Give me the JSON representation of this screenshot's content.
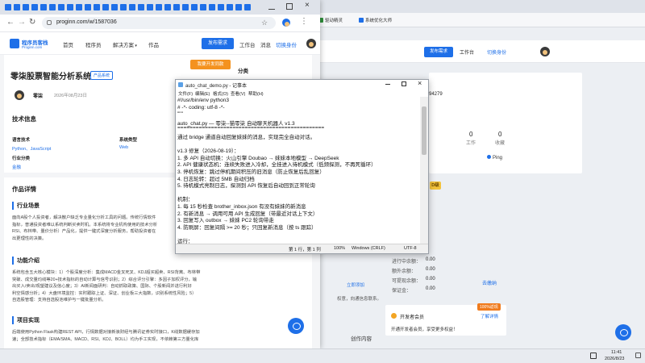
{
  "background_browser": {
    "bookmarks": [
      {
        "label": "驱动精灵",
        "color": "#2f8f3a"
      },
      {
        "label": "系统优化大师",
        "color": "#1e6fe8"
      }
    ],
    "header": {
      "publish_label": "发布需求",
      "workbench_label": "工作台",
      "switch_identity_label": "切换身份"
    },
    "partial_id": "94279",
    "stats": [
      {
        "value": "0",
        "label": "工作"
      },
      {
        "value": "0",
        "label": "收藏"
      }
    ],
    "ping_label": "Ping",
    "level_badge": "D级",
    "balances": [
      {
        "label": "进行中余额：",
        "value": "0.00"
      },
      {
        "label": "额外余额：",
        "value": "0.00"
      },
      {
        "label": "可提现余额：",
        "value": "0.00"
      },
      {
        "label": "保证金：",
        "value": "0.00"
      }
    ],
    "recharge_label": "去缴纳",
    "vip": {
      "badge": "100%返现",
      "title": "开发者会员",
      "link": "了解详情",
      "desc": "开通开发者会员，享受更多权益！"
    },
    "creation_label": "创作内容"
  },
  "browser": {
    "url": "proginn.com/w/1587036",
    "site_logo_cn": "程序员客栈",
    "site_logo_en": "Proginn.com",
    "nav": [
      "首页",
      "程序员",
      "解决方案",
      "作品"
    ],
    "publish_label": "发布需求",
    "workbench_label": "工作台",
    "messages_label": "消息",
    "switch_identity_label": "切换身份",
    "promo_button": "我要开发同款",
    "category_label": "分类",
    "product_title": "零柒股票智能分析系统",
    "product_tag": "产品系统",
    "author": "零柒",
    "date": "2026年08月23日",
    "tech_title": "技术信息",
    "lang_label": "语言技术",
    "lang_value": "Python、JavaScript",
    "system_label": "系统类型",
    "system_value": "Web",
    "industry_label": "行业分类",
    "industry_value": "金融",
    "detail_title": "作品详情",
    "industry_bg_title": "行业场景",
    "industry_bg_lines": [
      "面向A股个人投资者，解决散户缺乏专业量化分析工具的问题。传统行情软件",
      "指标，普通投资者难以系统判断买卖时机。本系统将专业机构使用的技术分析",
      "RSI、布林带、量价分析）产品化，提供一键式深度分析服务，帮助投资者在",
      "出更理性的决策。"
    ],
    "feature_title": "功能介绍",
    "feature_lines": [
      "系统包含五大核心模块：1）个股深度分析：集成MACD金叉死叉、KDJ超买超卖、RSI背离、布林带",
      "突破、成交量均线等20+技术指标的自动计算与信号识别；2）综合评分引擎：多因子加权评分，输",
      "出买入/卖出/观望建议及信心度；3）AI新闻面研判：自动抓取政策、国际、个股新闻并进行利好",
      "利空情感分析；4）大盘环境监控：实时跟踪上证、深证、创业板三大指数，识别系统性风险；5）",
      "自选股管理：支持自选股池维护与一键批量分析。"
    ],
    "impl_title": "项目实现",
    "impl_lines": [
      "后端使用Python Flask构建REST API，行情数据对接新浪财经与腾讯证券实时接口，K线数据缓存加",
      "速；全部技术指标（EMA/SMA、MACD、RSI、KDJ、BOLL）均为手工实现，不依赖第三方量化库"
    ],
    "side_link_add": "立即添加",
    "side_hint": "权意，向通信息联系。"
  },
  "notepad": {
    "title": "auto_chat_demo.py - 记事本",
    "menu": [
      "文件(F)",
      "编辑(E)",
      "格式(O)",
      "查看(V)",
      "帮助(H)"
    ],
    "lines": [
      "#!/usr/bin/env python3",
      "# -*- coding: utf-8 -*-",
      "\"\"\"",
      "auto_chat.py — 零柒--猫零柒 自动聊天机器人 v1.3",
      "================================================",
      "通过 bridge 通道自动回复妹妹的消息，实现完全自动对话。",
      "",
      "v1.3 修复（2026-08-19）：",
      "  1. 多 API 自动切换：火山引擎 Doubao → 妹妹本地模型 → DeepSeek",
      "  2. API 健康状态机：连续失败进入冷却，全挂进入待机模式（低频探测，不再死循环）",
      "  3. 停机恢复：跳过停机期间积压的旧消息（防止恢复后乱回复）",
      "  4. 日志轮转：超过 5MB 自动归档",
      "  5. 待机模式亮制日志，探测到 API 恢复后自动回到正常轮询",
      "",
      "机制：",
      "  1. 每 15 秒检查 brother_inbox.json 有没有妹妹的新消息",
      "  2. 有新消息 → 调用可用 API 生成回复（带最近对话上下文）",
      "  3. 回复写入 outbox → 妹妹 PC2 轮询带走",
      "  4. 防刷屏：回复间隔 >= 20 秒；只回复新消息（按 ts 跟踪）",
      "",
      "运行："
    ],
    "status": {
      "position": "第 1 行，第 1 列",
      "zoom": "100%",
      "line_ending": "Windows (CRLF)",
      "encoding": "UTF-8"
    }
  },
  "taskbar": {
    "time": "11:41",
    "date": "2026/8/23"
  }
}
